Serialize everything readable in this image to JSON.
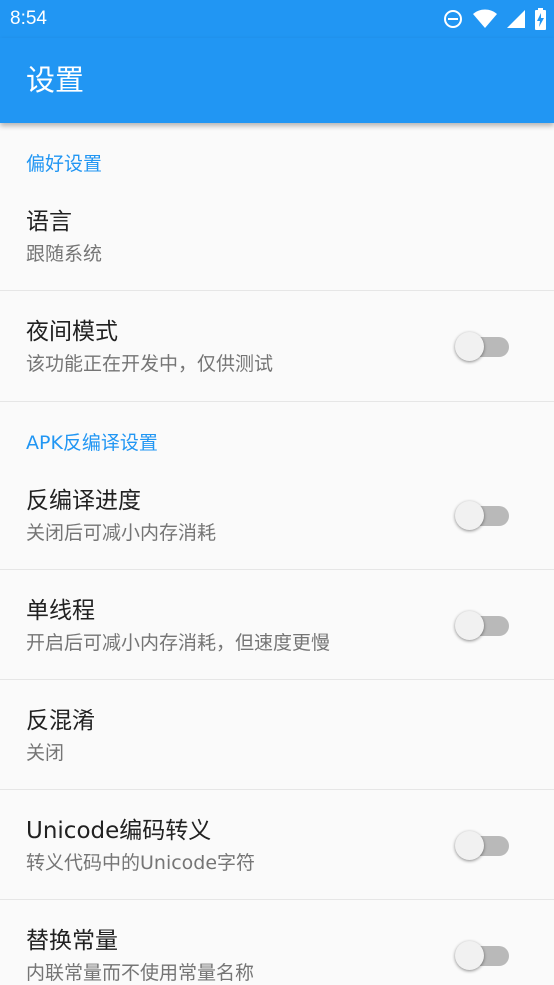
{
  "status_bar": {
    "time": "8:54",
    "icons": [
      "do-not-disturb-icon",
      "wifi-icon",
      "cell-signal-icon",
      "battery-charging-icon"
    ]
  },
  "app_bar": {
    "title": "设置",
    "background": "#2196f3"
  },
  "colors": {
    "accent": "#2196f3",
    "title_text": "#212121",
    "summary_text": "#757575",
    "switch_track_off": "#b9b9b9",
    "switch_thumb_off": "#f1f1f1"
  },
  "sections": [
    {
      "header": "偏好设置",
      "items": [
        {
          "title": "语言",
          "summary": "跟随系统",
          "switch": null
        },
        {
          "title": "夜间模式",
          "summary": "该功能正在开发中，仅供测试",
          "switch": false
        }
      ]
    },
    {
      "header": "APK反编译设置",
      "items": [
        {
          "title": "反编译进度",
          "summary": "关闭后可减小内存消耗",
          "switch": false
        },
        {
          "title": "单线程",
          "summary": "开启后可减小内存消耗，但速度更慢",
          "switch": false
        },
        {
          "title": "反混淆",
          "summary": "关闭",
          "switch": null
        },
        {
          "title": "Unicode编码转义",
          "summary": "转义代码中的Unicode字符",
          "switch": false
        },
        {
          "title": "替换常量",
          "summary": "内联常量而不使用常量名称",
          "switch": false
        }
      ]
    }
  ]
}
